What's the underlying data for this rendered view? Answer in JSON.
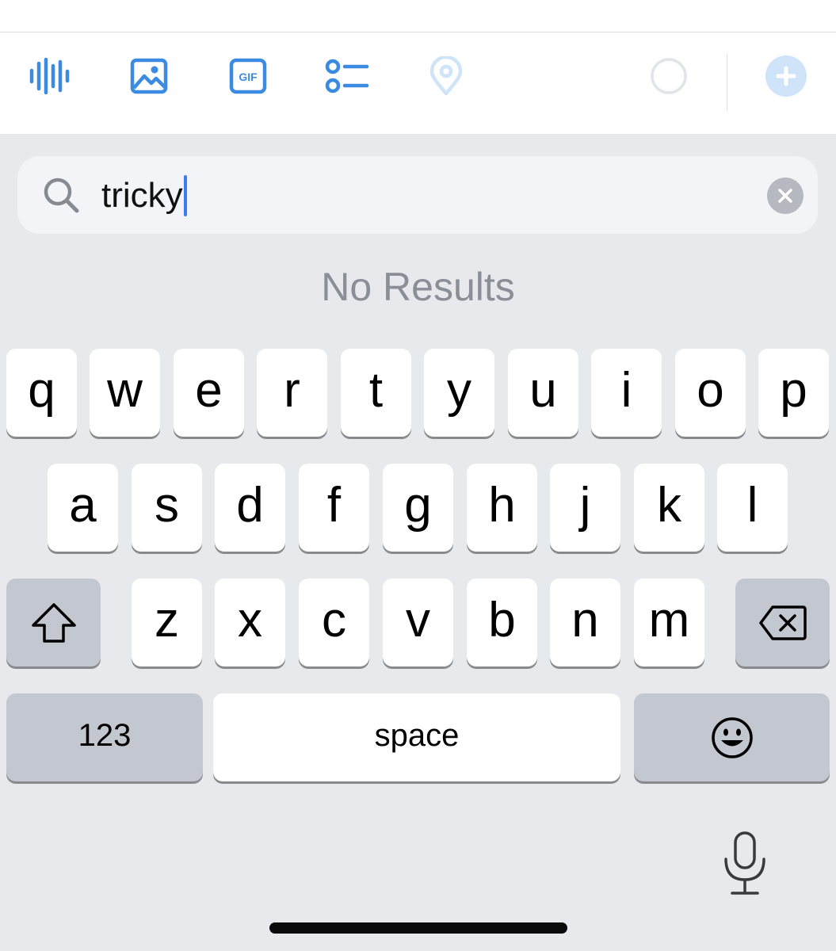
{
  "toolbar": {
    "items": [
      {
        "name": "voice-waveform"
      },
      {
        "name": "image"
      },
      {
        "name": "gif",
        "label": "GIF"
      },
      {
        "name": "poll"
      },
      {
        "name": "location"
      }
    ],
    "colors": {
      "accent": "#3b8be3",
      "accent_light": "#cfe4f8"
    }
  },
  "search": {
    "value": "tricky",
    "no_results_text": "No Results"
  },
  "keyboard": {
    "row1": [
      "q",
      "w",
      "e",
      "r",
      "t",
      "y",
      "u",
      "i",
      "o",
      "p"
    ],
    "row2": [
      "a",
      "s",
      "d",
      "f",
      "g",
      "h",
      "j",
      "k",
      "l"
    ],
    "row3": [
      "z",
      "x",
      "c",
      "v",
      "b",
      "n",
      "m"
    ],
    "numbers_label": "123",
    "space_label": "space"
  }
}
